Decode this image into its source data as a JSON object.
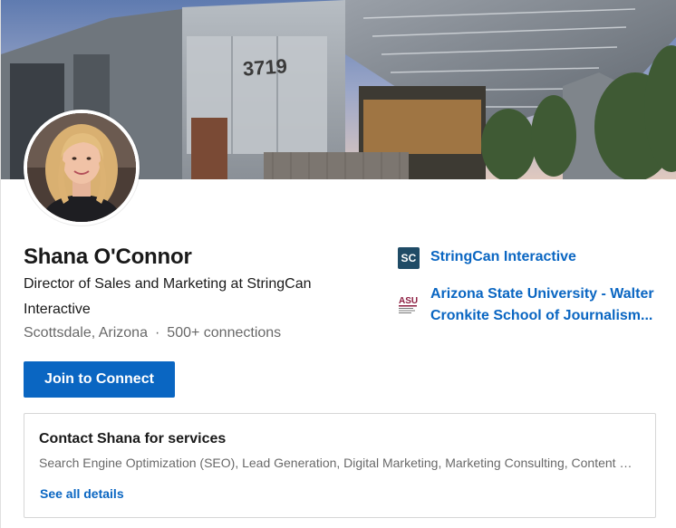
{
  "cover": {
    "building_number": "3719"
  },
  "profile": {
    "name": "Shana O'Connor",
    "headline": "Director of Sales and Marketing at StringCan Interactive",
    "location": "Scottsdale, Arizona",
    "separator": "·",
    "connections": "500+ connections",
    "join_button": "Join to Connect"
  },
  "orgs": [
    {
      "logo_text": "SC",
      "name": "StringCan Interactive",
      "logo_color": "#1f4b66"
    },
    {
      "logo_text": "ASU",
      "name_line1": "Arizona State University - Walter",
      "name_line2": "Cronkite School of Journalism...",
      "logo_color": "#8c1d40"
    }
  ],
  "services": {
    "title": "Contact Shana for services",
    "list": "Search Engine Optimization (SEO), Lead Generation, Digital Marketing, Marketing Consulting, Content Marketing",
    "see_all": "See all details"
  },
  "colors": {
    "accent": "#0a66c2",
    "text_primary": "#1a1a1a",
    "text_secondary": "#666666"
  }
}
